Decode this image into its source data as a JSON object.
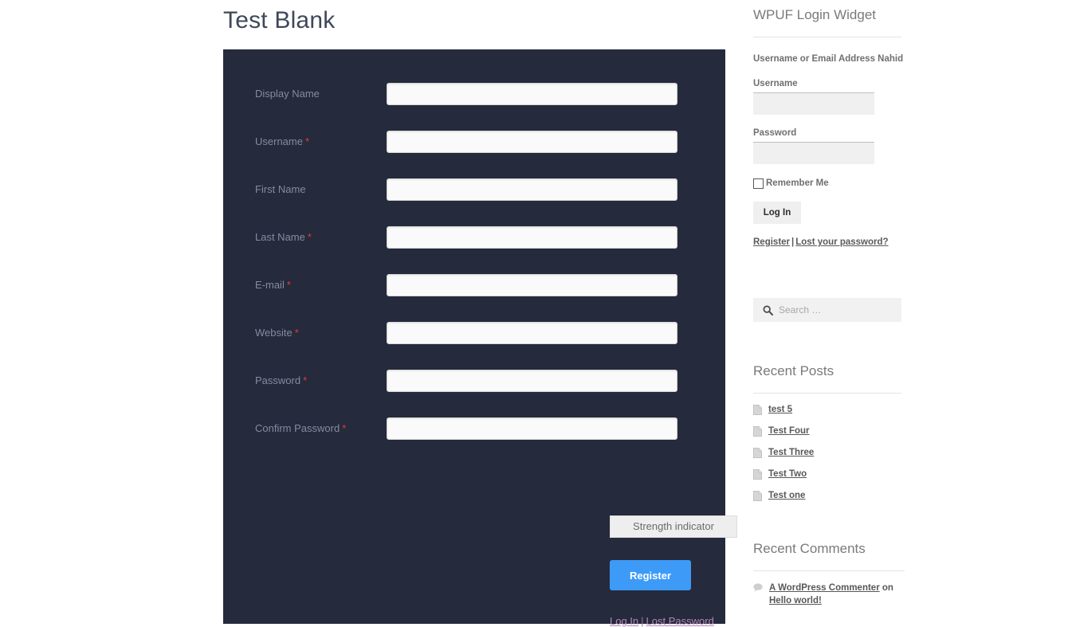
{
  "page": {
    "title": "Test Blank"
  },
  "registration_form": {
    "fields": [
      {
        "label": "Display Name",
        "required": false,
        "value": "",
        "name": "display-name"
      },
      {
        "label": "Username",
        "required": true,
        "value": "",
        "name": "username"
      },
      {
        "label": "First Name",
        "required": false,
        "value": "",
        "name": "first-name"
      },
      {
        "label": "Last Name",
        "required": true,
        "value": "",
        "name": "last-name"
      },
      {
        "label": "E-mail",
        "required": true,
        "value": "",
        "name": "email"
      },
      {
        "label": "Website",
        "required": true,
        "value": "",
        "name": "website"
      },
      {
        "label": "Password",
        "required": true,
        "value": "",
        "name": "password"
      },
      {
        "label": "Confirm Password",
        "required": true,
        "value": "",
        "name": "confirm-password"
      }
    ],
    "required_marker": "*",
    "strength_indicator": "Strength indicator",
    "submit_label": "Register",
    "login_link": "Log In",
    "separator": "|",
    "lost_password_link": "Lost Password",
    "background_color": "#252a3c",
    "submit_color": "#3d9bf7",
    "required_color": "#e8393a",
    "label_color": "#838c9f"
  },
  "sidebar": {
    "login_widget": {
      "title": "WPUF Login Widget",
      "status_text": "Username or Email Address Nahid",
      "username_label": "Username",
      "username_value": "",
      "password_label": "Password",
      "password_value": "",
      "remember_label": "Remember Me",
      "remember_checked": false,
      "login_button": "Log In",
      "register_link": "Register",
      "separator": "|",
      "lost_password_link": "Lost your password?"
    },
    "search_widget": {
      "placeholder": "Search …",
      "value": "",
      "icon": "search-icon"
    },
    "recent_posts": {
      "title": "Recent Posts",
      "items": [
        {
          "label": "test 5",
          "icon": "document-icon"
        },
        {
          "label": "Test Four",
          "icon": "document-icon"
        },
        {
          "label": "Test Three",
          "icon": "document-icon"
        },
        {
          "label": "Test Two",
          "icon": "document-icon"
        },
        {
          "label": "Test one",
          "icon": "document-icon"
        }
      ]
    },
    "recent_comments": {
      "title": "Recent Comments",
      "items": [
        {
          "author": "A WordPress Commenter",
          "connector": " on ",
          "post": "Hello world!",
          "icon": "comment-bubble-icon"
        }
      ]
    }
  }
}
